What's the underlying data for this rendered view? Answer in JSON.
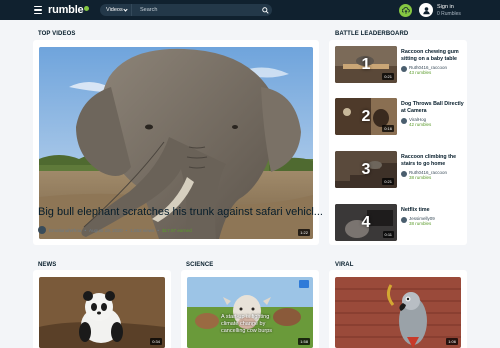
{
  "header": {
    "logo_text": "rumble",
    "search_category": "Videos",
    "search_placeholder": "Search",
    "signin_label": "Sign in",
    "rumbles_label": "0 Rumbles",
    "colors": {
      "bar": "#10212f",
      "accent": "#85c742"
    }
  },
  "top_videos": {
    "title": "TOP VIDEOS",
    "video": {
      "title": "Big bull elephant scratches his trunk against safari vehicl...",
      "duration": "1:22",
      "channel": "EmotionalWhoa",
      "date": "August 19, 2020",
      "views": "1,552 views",
      "earned": "$17.97 earned"
    }
  },
  "leaderboard": {
    "title": "BATTLE LEADERBOARD",
    "items": [
      {
        "rank": "1",
        "title": "Raccoon chewing gum sitting on a baby table",
        "channel": "Ruth0416_raccoon",
        "rumbles": "43 rumbles",
        "duration": "0:21"
      },
      {
        "rank": "2",
        "title": "Dog Throws Ball Directly at Camera",
        "channel": "ViralHog",
        "rumbles": "42 rumbles",
        "duration": "0:16"
      },
      {
        "rank": "3",
        "title": "Raccoon climbing the stairs to go home",
        "channel": "Ruth0416_raccoon",
        "rumbles": "38 rumbles",
        "duration": "0:21"
      },
      {
        "rank": "4",
        "title": "Netflix time",
        "channel": "Jessimelly09",
        "rumbles": "38 rumbles",
        "duration": "0:11"
      }
    ]
  },
  "sections": [
    {
      "title": "NEWS",
      "duration": "0:34",
      "caption": ""
    },
    {
      "title": "SCIENCE",
      "duration": "1:58",
      "caption": "A start-up is fighting climate change by cancelling cow burps"
    },
    {
      "title": "VIRAL",
      "duration": "1:06",
      "caption": ""
    }
  ]
}
